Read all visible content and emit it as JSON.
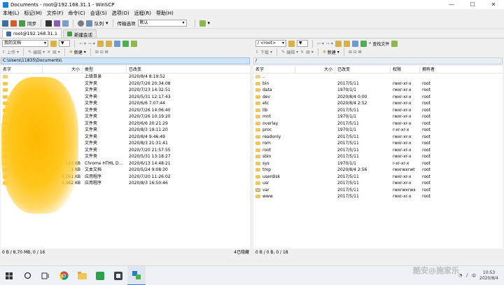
{
  "window": {
    "title": "Documents - root@192.168.31.1 - WinSCP",
    "controls": [
      "—",
      "☐",
      "✕"
    ]
  },
  "menu": [
    "本地(L)",
    "标记(M)",
    "文件(F)",
    "命令(C)",
    "会话(S)",
    "选项(O)",
    "远程(R)",
    "帮助(H)"
  ],
  "toolbar": {
    "sync_label": "同步",
    "queue_label": "队列",
    "transfer_label": "传输选项",
    "transfer_value": "默认"
  },
  "tabs": [
    {
      "label": "root@192.168.31.1"
    },
    {
      "label": "新建会话"
    }
  ],
  "left": {
    "drive": "我的文档",
    "buttons": {
      "upload": "上传",
      "edit": "编辑",
      "new": "新建"
    },
    "path": "C:\\Users\\11835\\Documents\\",
    "columns": [
      "名字",
      "大小",
      "类型",
      "已改变"
    ],
    "rows": [
      {
        "name": "",
        "size": "",
        "type": "上级目录",
        "changed": "2020/8/4  8:19:52"
      },
      {
        "name": "",
        "size": "",
        "type": "文件夹",
        "changed": "2020/7/26  20:34:08"
      },
      {
        "name": "",
        "size": "",
        "type": "文件夹",
        "changed": "2020/7/23  14:32:51"
      },
      {
        "name": "",
        "size": "",
        "type": "文件夹",
        "changed": "2020/5/31  12:17:43"
      },
      {
        "name": "",
        "size": "",
        "type": "文件夹",
        "changed": "2020/6/6  7:07:44"
      },
      {
        "name": "",
        "size": "",
        "type": "文件夹",
        "changed": "2020/7/26  14:06:40"
      },
      {
        "name": "",
        "size": "",
        "type": "文件夹",
        "changed": "2020/7/26  10:19:20"
      },
      {
        "name": "",
        "size": "",
        "type": "文件夹",
        "changed": "2020/6/6  20:21:29"
      },
      {
        "name": "",
        "size": "",
        "type": "文件夹",
        "changed": "2020/8/3  19:11:20"
      },
      {
        "name": "",
        "size": "",
        "type": "文件夹",
        "changed": "2020/8/4  9:46:49"
      },
      {
        "name": "",
        "size": "",
        "type": "文件夹",
        "changed": "2020/8/3  21:31:41"
      },
      {
        "name": "",
        "size": "",
        "type": "文件夹",
        "changed": "2020/7/20  21:57:55"
      },
      {
        "name": "",
        "size": "",
        "type": "文件夹",
        "changed": "2020/5/31  13:18:27"
      },
      {
        "name": "",
        "size": "193 KB",
        "type": "Chrome HTML D...",
        "changed": "2020/6/13  14:48:21"
      },
      {
        "name": "",
        "size": "1 KB",
        "type": "文本文档",
        "changed": "2020/5/24  9:08:30"
      },
      {
        "name": "",
        "size": "4,361 KB",
        "type": "应用程序",
        "changed": "2020/7/20  11:26:02"
      },
      {
        "name": "",
        "size": "4,362 KB",
        "type": "应用程序",
        "changed": "2020/8/3  16:50:46"
      }
    ],
    "status_left": "0 B / 8.70 MB,  0 / 16",
    "status_right": "4已隐藏"
  },
  "right": {
    "drive": "/ <root>",
    "buttons": {
      "download": "下载",
      "edit": "编辑",
      "new": "新建",
      "find": "查找文件"
    },
    "path": "/",
    "columns": [
      "名字",
      "大小",
      "已改变",
      "权限",
      "拥有者"
    ],
    "rows": [
      {
        "name": "..",
        "changed": "",
        "rights": "",
        "owner": ""
      },
      {
        "name": "bin",
        "changed": "2017/5/11",
        "rights": "rwxr-xr-x",
        "owner": "root"
      },
      {
        "name": "data",
        "changed": "1970/1/1",
        "rights": "rwxr-xr-x",
        "owner": "root"
      },
      {
        "name": "dev",
        "changed": "2020/8/4 0:00",
        "rights": "rwxr-xr-x",
        "owner": "root"
      },
      {
        "name": "etc",
        "changed": "2020/8/4 2:52",
        "rights": "rwxr-xr-x",
        "owner": "root"
      },
      {
        "name": "lib",
        "changed": "2017/5/11",
        "rights": "rwxr-xr-x",
        "owner": "root"
      },
      {
        "name": "mnt",
        "changed": "1970/1/1",
        "rights": "rwxr-xr-x",
        "owner": "root"
      },
      {
        "name": "overlay",
        "changed": "2017/5/11",
        "rights": "rwxr-xr-x",
        "owner": "root"
      },
      {
        "name": "proc",
        "changed": "1970/1/1",
        "rights": "r-xr-xr-x",
        "owner": "root"
      },
      {
        "name": "readonly",
        "changed": "2017/5/11",
        "rights": "rwxr-xr-x",
        "owner": "root"
      },
      {
        "name": "rom",
        "changed": "2017/5/11",
        "rights": "rwxr-xr-x",
        "owner": "root"
      },
      {
        "name": "root",
        "changed": "2017/5/11",
        "rights": "rwxr-xr-x",
        "owner": "root"
      },
      {
        "name": "sbin",
        "changed": "2017/5/11",
        "rights": "rwxr-xr-x",
        "owner": "root"
      },
      {
        "name": "sys",
        "changed": "1970/1/1",
        "rights": "r-xr-xr-x",
        "owner": "root"
      },
      {
        "name": "tmp",
        "changed": "2020/8/4 2:56",
        "rights": "rwxrwxrwt",
        "owner": "root"
      },
      {
        "name": "userdisk",
        "changed": "2017/5/11",
        "rights": "rwxr-xr-x",
        "owner": "root"
      },
      {
        "name": "usr",
        "changed": "2017/5/11",
        "rights": "rwxr-xr-x",
        "owner": "root"
      },
      {
        "name": "var",
        "changed": "2017/5/11",
        "rights": "rwxrwxrwx",
        "owner": "root"
      },
      {
        "name": "www",
        "changed": "2017/5/11",
        "rights": "rwxr-xr-x",
        "owner": "root"
      }
    ],
    "status": "0 B / 0 B,  0 / 18"
  },
  "taskbar": {
    "time": "10:53",
    "date": "2020/8/4"
  },
  "watermark": "酷安@施家乐",
  "colors": {
    "path_active": "#cfe4f7",
    "folder": "#f3c653",
    "redaction": "#ffc61a"
  }
}
